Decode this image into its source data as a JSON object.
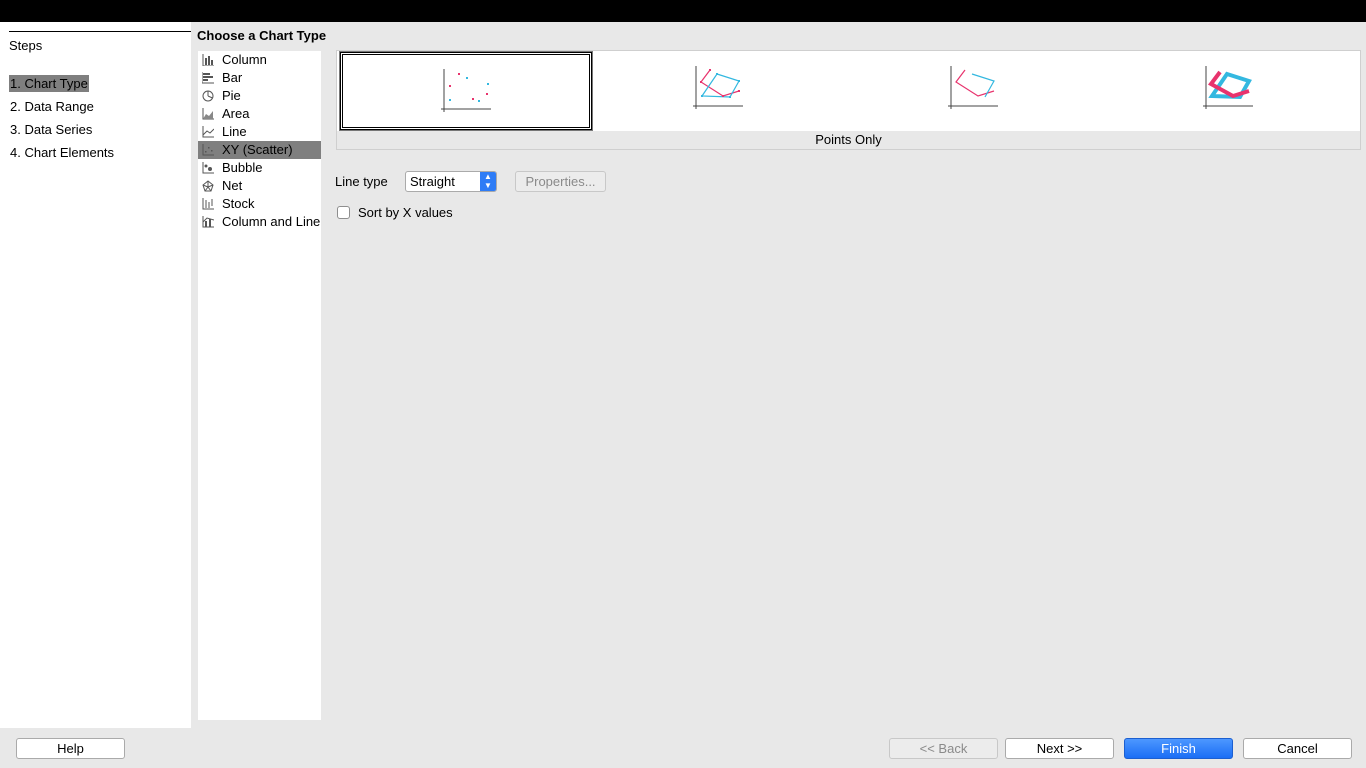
{
  "steps": {
    "title": "Steps",
    "items": [
      "1. Chart Type",
      "2. Data Range",
      "3. Data Series",
      "4. Chart Elements"
    ],
    "active_index": 0
  },
  "chart_type": {
    "heading": "Choose a Chart Type",
    "types": [
      {
        "label": "Column",
        "icon": "column-chart-icon"
      },
      {
        "label": "Bar",
        "icon": "bar-chart-icon"
      },
      {
        "label": "Pie",
        "icon": "pie-chart-icon"
      },
      {
        "label": "Area",
        "icon": "area-chart-icon"
      },
      {
        "label": "Line",
        "icon": "line-chart-icon"
      },
      {
        "label": "XY (Scatter)",
        "icon": "scatter-chart-icon"
      },
      {
        "label": "Bubble",
        "icon": "bubble-chart-icon"
      },
      {
        "label": "Net",
        "icon": "net-chart-icon"
      },
      {
        "label": "Stock",
        "icon": "stock-chart-icon"
      },
      {
        "label": "Column and Line",
        "icon": "column-and-line-chart-icon"
      }
    ],
    "selected_type_index": 5
  },
  "variants": {
    "selected_index": 0,
    "caption": "Points Only",
    "icons": [
      "points-only-icon",
      "points-and-lines-icon",
      "lines-only-icon",
      "3d-lines-icon"
    ]
  },
  "options": {
    "line_type_label": "Line type",
    "line_type_value": "Straight",
    "properties_label": "Properties...",
    "sort_label": "Sort by X values",
    "sort_checked": false
  },
  "buttons": {
    "help": "Help",
    "back": "<< Back",
    "next": "Next >>",
    "finish": "Finish",
    "cancel": "Cancel"
  },
  "colors": {
    "selection": "#7f7f7f",
    "primary_button": "#1a6ef5",
    "series_pink": "#e8336d",
    "series_cyan": "#33b8e0"
  }
}
